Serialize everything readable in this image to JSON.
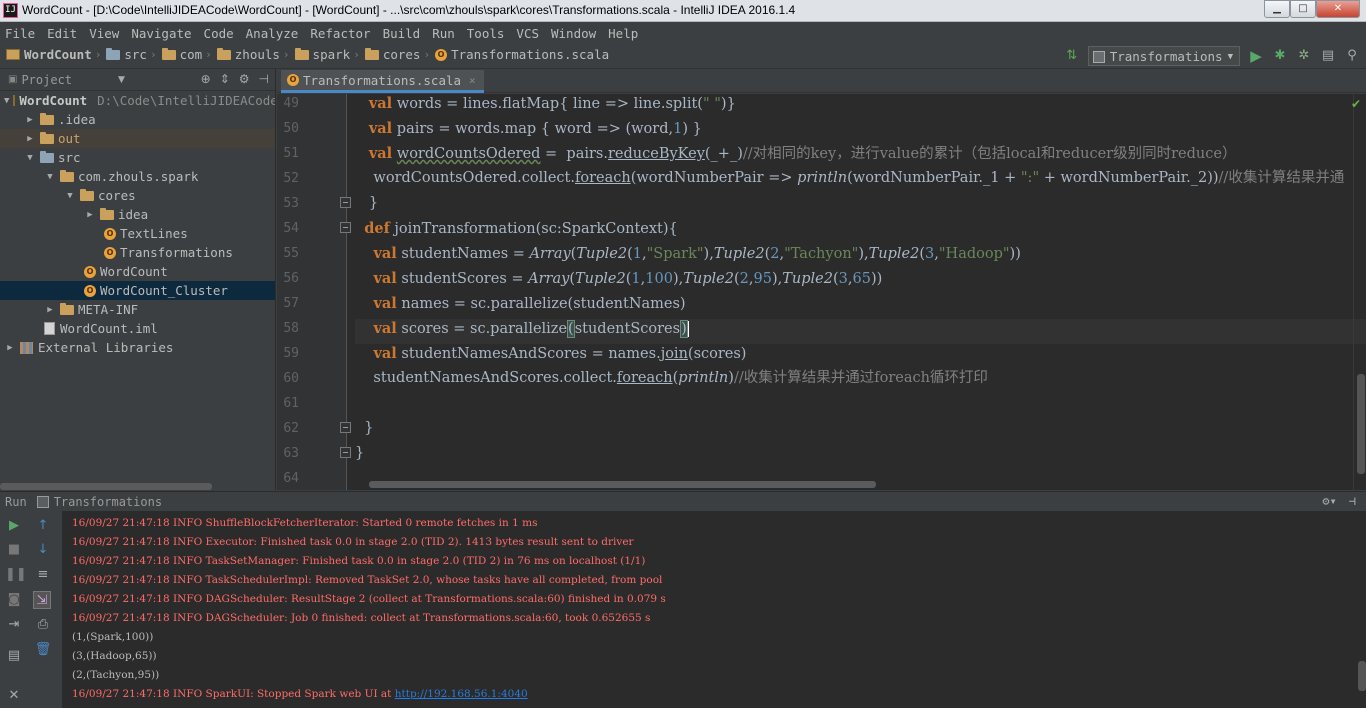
{
  "window": {
    "title": "WordCount - [D:\\Code\\IntelliJIDEACode\\WordCount] - [WordCount] - ...\\src\\com\\zhouls\\spark\\cores\\Transformations.scala - IntelliJ IDEA 2016.1.4",
    "icon_text": "IJ",
    "minimize": "▁",
    "maximize": "□",
    "close": "✕"
  },
  "menu": [
    "File",
    "Edit",
    "View",
    "Navigate",
    "Code",
    "Analyze",
    "Refactor",
    "Build",
    "Run",
    "Tools",
    "VCS",
    "Window",
    "Help"
  ],
  "breadcrumbs": [
    "WordCount",
    "src",
    "com",
    "zhouls",
    "spark",
    "cores",
    "Transformations.scala"
  ],
  "run_config": {
    "name": "Transformations",
    "run_icon": "run-icon",
    "debug_icon": "debug-icon",
    "coverage_icon": "coverage-icon"
  },
  "project_panel": {
    "title": "Project",
    "tree": [
      {
        "label": "WordCount",
        "extra": "D:\\Code\\IntelliJIDEACode\\WordCount",
        "depth": 0,
        "arrow": "▼",
        "icon": "module"
      },
      {
        "label": ".idea",
        "depth": 1,
        "arrow": "▶",
        "icon": "folder"
      },
      {
        "label": "out",
        "depth": 1,
        "arrow": "▶",
        "icon": "folder-orange"
      },
      {
        "label": "src",
        "depth": 1,
        "arrow": "▼",
        "icon": "folder-blue"
      },
      {
        "label": "com.zhouls.spark",
        "depth": 2,
        "arrow": "▼",
        "icon": "folder"
      },
      {
        "label": "cores",
        "depth": 3,
        "arrow": "▼",
        "icon": "folder"
      },
      {
        "label": "idea",
        "depth": 4,
        "arrow": "▶",
        "icon": "folder"
      },
      {
        "label": "TextLines",
        "depth": 5,
        "arrow": "",
        "icon": "object"
      },
      {
        "label": "Transformations",
        "depth": 5,
        "arrow": "",
        "icon": "object"
      },
      {
        "label": "WordCount",
        "depth": 4,
        "arrow": "",
        "icon": "object"
      },
      {
        "label": "WordCount_Cluster",
        "depth": 4,
        "arrow": "",
        "icon": "object"
      },
      {
        "label": "META-INF",
        "depth": 2,
        "arrow": "▶",
        "icon": "folder"
      },
      {
        "label": "WordCount.iml",
        "depth": 2,
        "arrow": "",
        "icon": "file"
      },
      {
        "label": "External Libraries",
        "depth": 0,
        "arrow": "▶",
        "icon": "library"
      }
    ]
  },
  "editor": {
    "tab": "Transformations.scala",
    "line_numbers": [
      "49",
      "50",
      "51",
      "52",
      "53",
      "54",
      "55",
      "56",
      "57",
      "58",
      "59",
      "60",
      "61",
      "62",
      "63",
      "64"
    ]
  },
  "run_panel": {
    "label": "Run",
    "tab": "Transformations",
    "console": [
      "16/09/27 21:47:18 INFO ShuffleBlockFetcherIterator: Started 0 remote fetches in 1 ms",
      "16/09/27 21:47:18 INFO Executor: Finished task 0.0 in stage 2.0 (TID 2). 1413 bytes result sent to driver",
      "16/09/27 21:47:18 INFO TaskSetManager: Finished task 0.0 in stage 2.0 (TID 2) in 76 ms on localhost (1/1)",
      "16/09/27 21:47:18 INFO TaskSchedulerImpl: Removed TaskSet 2.0, whose tasks have all completed, from pool",
      "16/09/27 21:47:18 INFO DAGScheduler: ResultStage 2 (collect at Transformations.scala:60) finished in 0.079 s",
      "16/09/27 21:47:18 INFO DAGScheduler: Job 0 finished: collect at Transformations.scala:60, took 0.652655 s",
      "(1,(Spark,100))",
      "(3,(Hadoop,65))",
      "(2,(Tachyon,95))"
    ],
    "last_line_prefix": "16/09/27 21:47:18 INFO SparkUI: Stopped Spark web UI at ",
    "last_line_link": "http://192.168.56.1:4040"
  },
  "colors": {
    "editor_bg": "#2b2b2b",
    "panel_bg": "#3c3f41",
    "keyword": "#cc7832",
    "string": "#6a8759",
    "number": "#6897bb",
    "comment": "#808080",
    "stderr": "#ff6b68",
    "link": "#287bde"
  }
}
